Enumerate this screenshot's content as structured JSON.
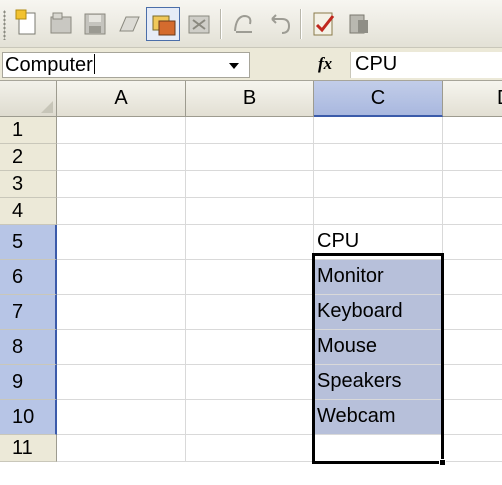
{
  "toolbar": {
    "buttons": [
      {
        "icon": "new-document-icon"
      },
      {
        "icon": "open-icon"
      },
      {
        "icon": "save-icon"
      },
      {
        "icon": "print-icon"
      },
      {
        "icon": "copy-icon",
        "state": "pressed"
      },
      {
        "icon": "paste-icon"
      },
      {
        "icon": "format-painter-icon"
      },
      {
        "icon": "undo-icon"
      },
      {
        "icon": "spelling-icon"
      },
      {
        "icon": "toolbar-overflow-icon"
      }
    ]
  },
  "formula_bar": {
    "name_box_value": "Computer",
    "fx_label": "fx",
    "formula_value": "CPU"
  },
  "sheet": {
    "columns": [
      "A",
      "B",
      "C",
      "D"
    ],
    "selected_column": "C",
    "rows": [
      "1",
      "2",
      "3",
      "4",
      "5",
      "6",
      "7",
      "8",
      "9",
      "10",
      "11"
    ],
    "selected_rows": [
      "5",
      "6",
      "7",
      "8",
      "9",
      "10"
    ],
    "active_cell": "C5",
    "selection_range": "C5:C10",
    "cells": {
      "C5": "CPU",
      "C6": "Monitor",
      "C7": "Keyboard",
      "C8": "Mouse",
      "C9": "Speakers",
      "C10": "Webcam"
    }
  },
  "colors": {
    "selection_fill": "#b7c0da",
    "header_highlight": "#b7c5e6",
    "selection_border": "#000000"
  }
}
